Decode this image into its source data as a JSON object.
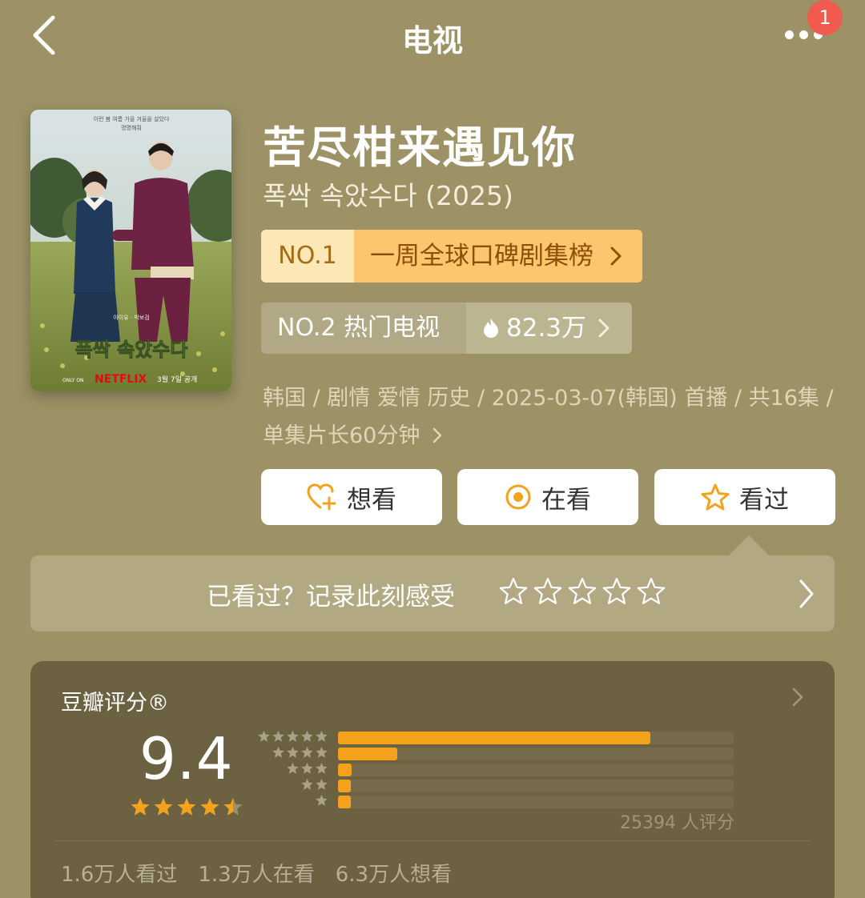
{
  "header": {
    "title": "电视",
    "notification_count": "1"
  },
  "show": {
    "title": "苦尽柑来遇见你",
    "original_title": "폭싹 속았수다 (2025)",
    "poster": {
      "top_text_line1": "이런 봄 여름 가을 겨울을 살았다",
      "top_text_line2": "명명해줘",
      "title_text": "폭싹 속았수다",
      "cast_text": "아이유 · 박보검",
      "netflix_label": "NETFLIX",
      "date_text": "3월 7일 공개",
      "only_on": "ONLY ON"
    }
  },
  "rankings": {
    "primary": {
      "rank": "NO.1",
      "label": "一周全球口碑剧集榜"
    },
    "secondary": {
      "rank_label": "NO.2 热门电视",
      "heat": "82.3万"
    }
  },
  "meta": {
    "text": "韩国 / 剧情 爱情 历史 / 2025-03-07(韩国) 首播 / 共16集 / 单集片长60分钟"
  },
  "actions": {
    "want": "想看",
    "watching": "在看",
    "watched": "看过"
  },
  "record": {
    "prompt": "已看过？记录此刻感受",
    "stars_total": 5
  },
  "rating": {
    "label": "豆瓣评分®",
    "score": "9.4",
    "score_stars": 4.5,
    "distribution": [
      {
        "stars": 5,
        "fraction": 0.79
      },
      {
        "stars": 4,
        "fraction": 0.15
      },
      {
        "stars": 3,
        "fraction": 0.035
      },
      {
        "stars": 2,
        "fraction": 0.025
      },
      {
        "stars": 1,
        "fraction": 0.025
      }
    ],
    "count_text": "25394 人评分",
    "stats": [
      "1.6万人看过",
      "1.3万人在看",
      "6.3万人想看"
    ]
  },
  "colors": {
    "accent_orange": "#f4a21c",
    "badge_red": "#f05a4f",
    "background": "#9c9266"
  }
}
